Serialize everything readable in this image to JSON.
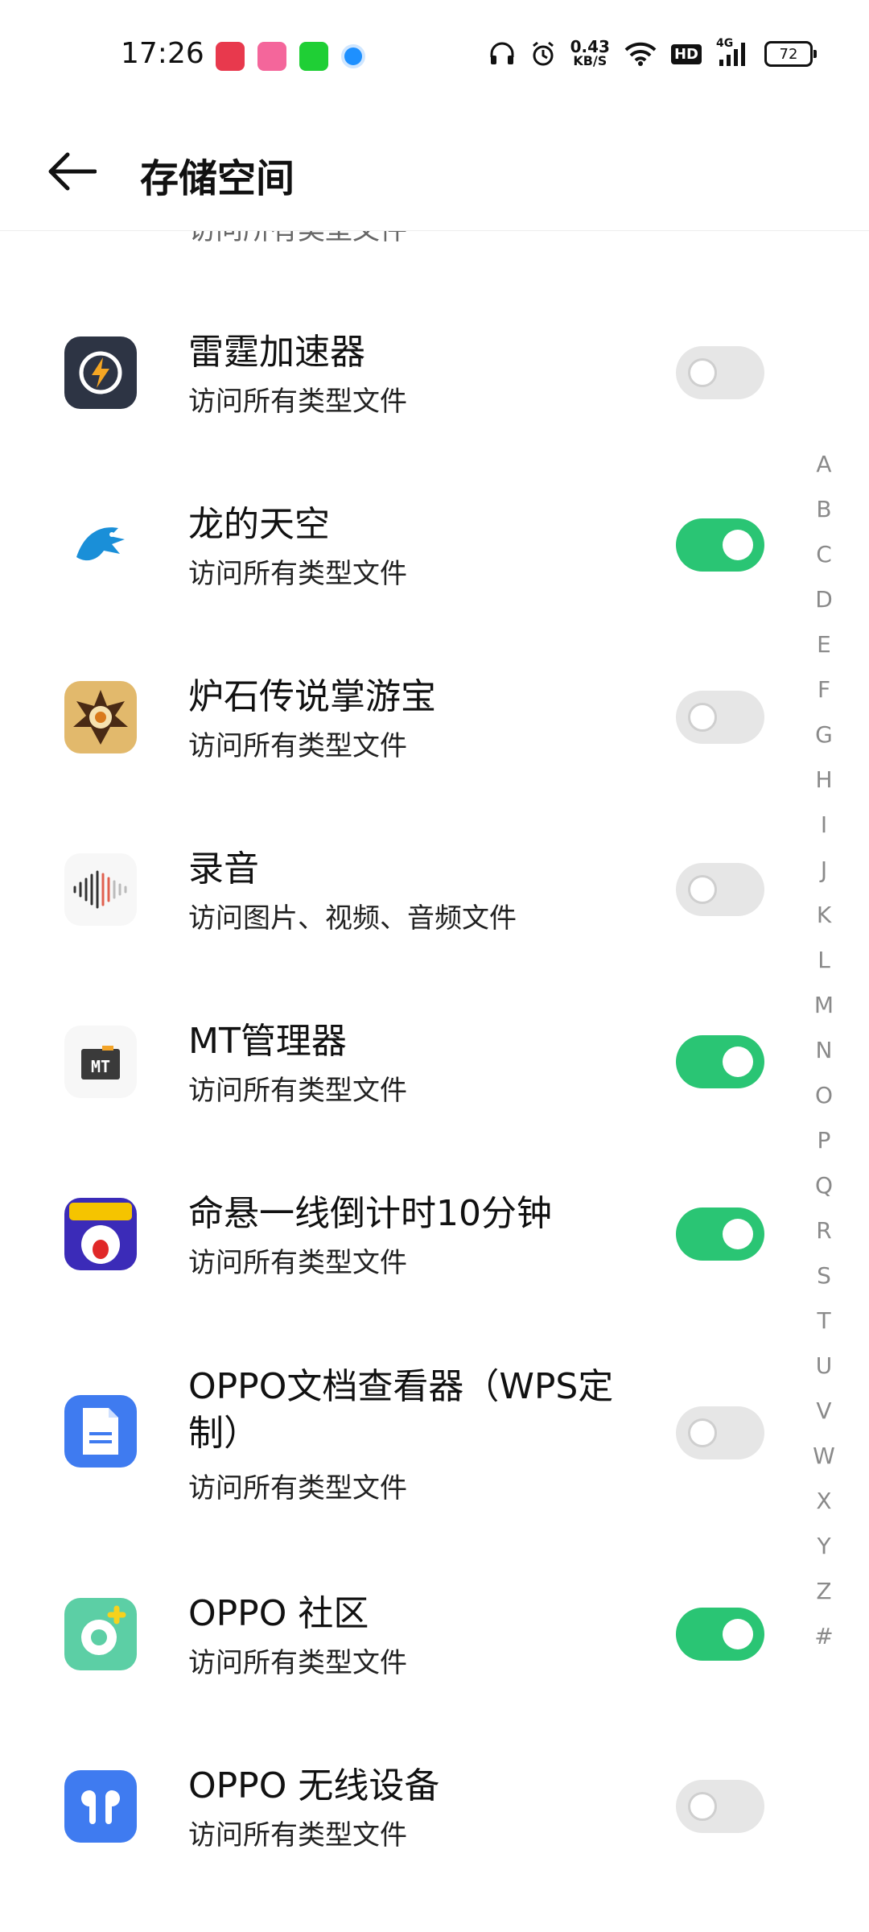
{
  "status_bar": {
    "time": "17:26",
    "net_speed_value": "0.43",
    "net_speed_unit": "KB/S",
    "hd": "HD",
    "signal": "4G",
    "battery": "72"
  },
  "header": {
    "title": "存储空间"
  },
  "partial_row_desc": "访问所有类型文件",
  "apps": [
    {
      "name": "雷霆加速器",
      "desc": "访问所有类型文件",
      "enabled": false
    },
    {
      "name": "龙的天空",
      "desc": "访问所有类型文件",
      "enabled": true
    },
    {
      "name": "炉石传说掌游宝",
      "desc": "访问所有类型文件",
      "enabled": false
    },
    {
      "name": "录音",
      "desc": "访问图片、视频、音频文件",
      "enabled": false
    },
    {
      "name": "MT管理器",
      "desc": "访问所有类型文件",
      "enabled": true
    },
    {
      "name": "命悬一线倒计时10分钟",
      "desc": "访问所有类型文件",
      "enabled": true
    },
    {
      "name": "OPPO文档查看器（WPS定制）",
      "desc": "访问所有类型文件",
      "enabled": false
    },
    {
      "name": "OPPO 社区",
      "desc": "访问所有类型文件",
      "enabled": true
    },
    {
      "name": "OPPO 无线设备",
      "desc": "访问所有类型文件",
      "enabled": false
    }
  ],
  "index_letters": [
    "A",
    "B",
    "C",
    "D",
    "E",
    "F",
    "G",
    "H",
    "I",
    "J",
    "K",
    "L",
    "M",
    "N",
    "O",
    "P",
    "Q",
    "R",
    "S",
    "T",
    "U",
    "V",
    "W",
    "X",
    "Y",
    "Z",
    "#"
  ],
  "colors": {
    "toggle_on": "#2ac574",
    "toggle_off": "#e6e6e6"
  }
}
